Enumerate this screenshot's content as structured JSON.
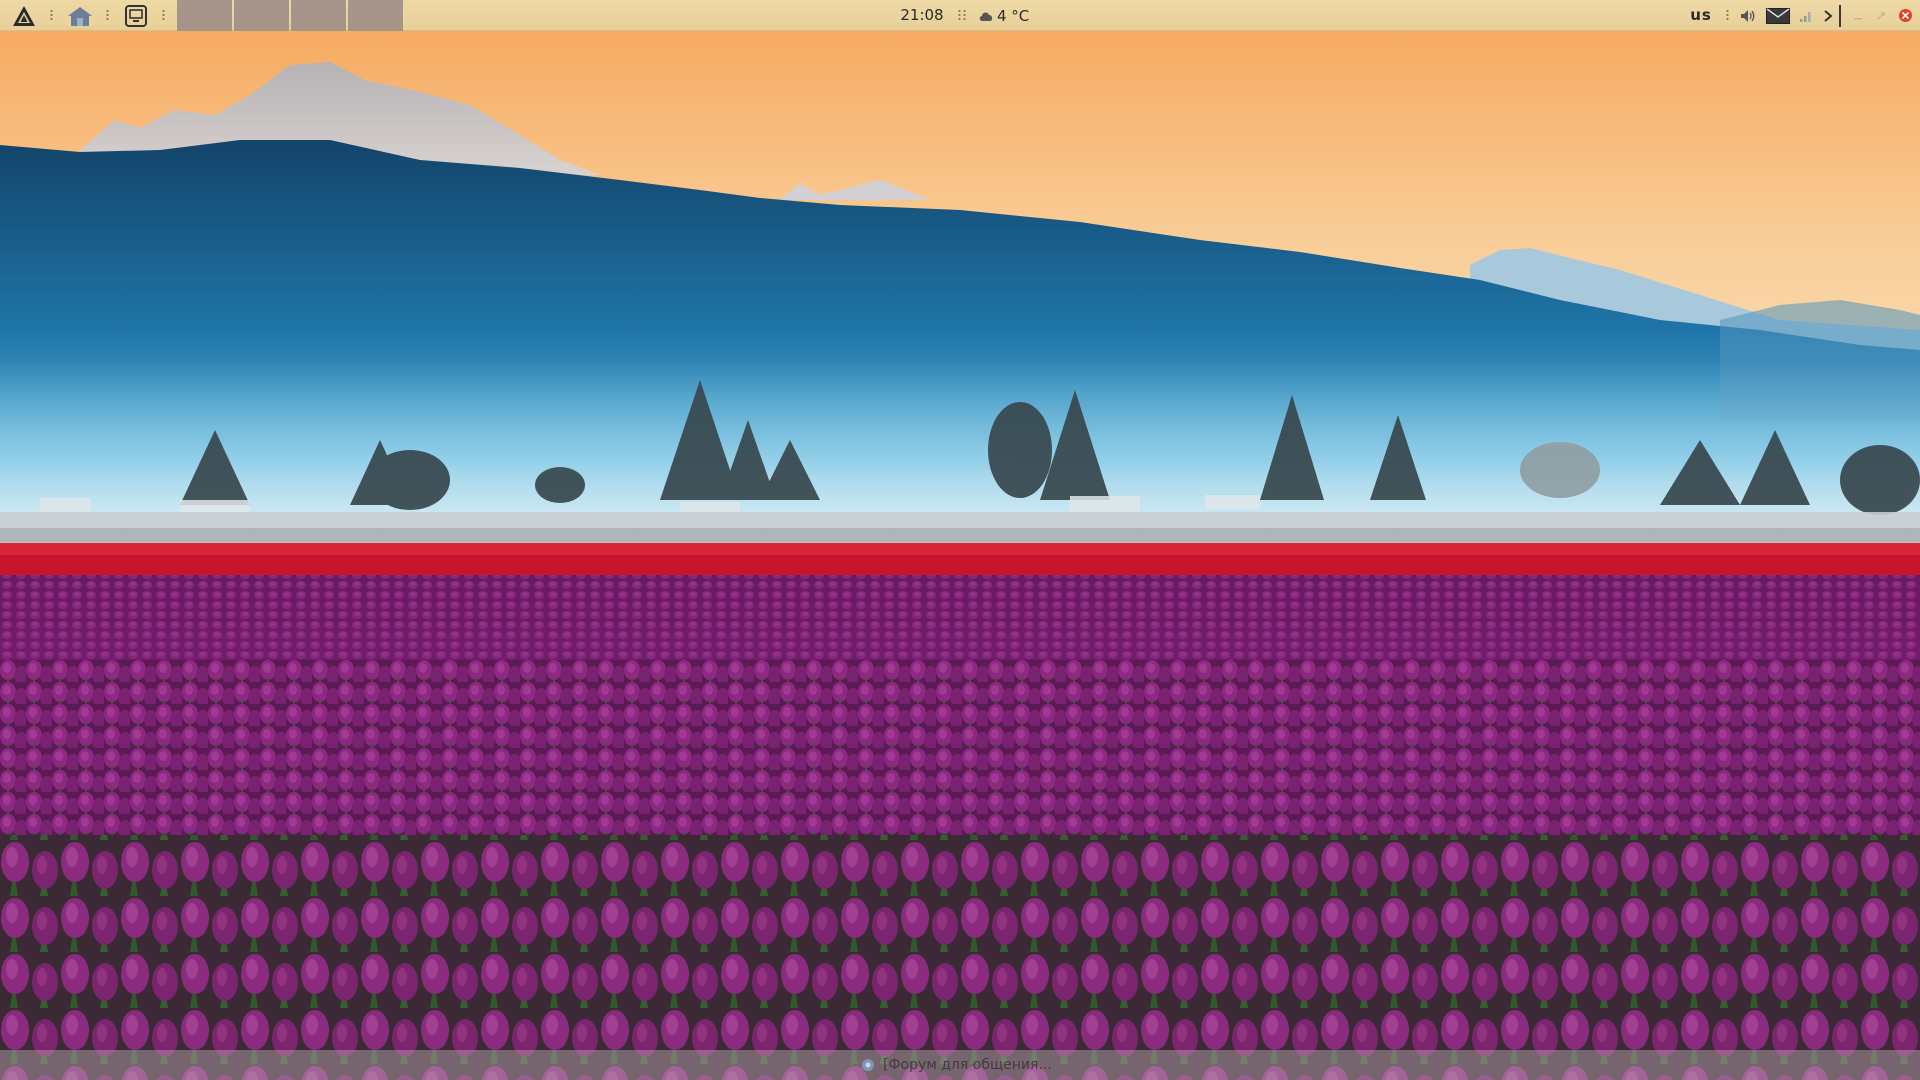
{
  "top_panel": {
    "clock": "21:08",
    "weather_temperature": "4 °C",
    "keyboard_layout": "us",
    "icons": [
      "app-menu-icon",
      "home-folder-icon",
      "show-desktop-icon",
      "weather-cloud-icon",
      "volume-icon",
      "mail-icon",
      "network-signal-icon",
      "expand-arrow-icon",
      "minimize-icon",
      "maximize-icon",
      "close-icon"
    ],
    "task_slots": 4
  },
  "bottom_taskbar": {
    "task_title": "[Форум для общения..."
  },
  "colors": {
    "panel_background": "#eed9a6",
    "close_red": "#e0402e",
    "task_slot": "#9a8a86"
  }
}
